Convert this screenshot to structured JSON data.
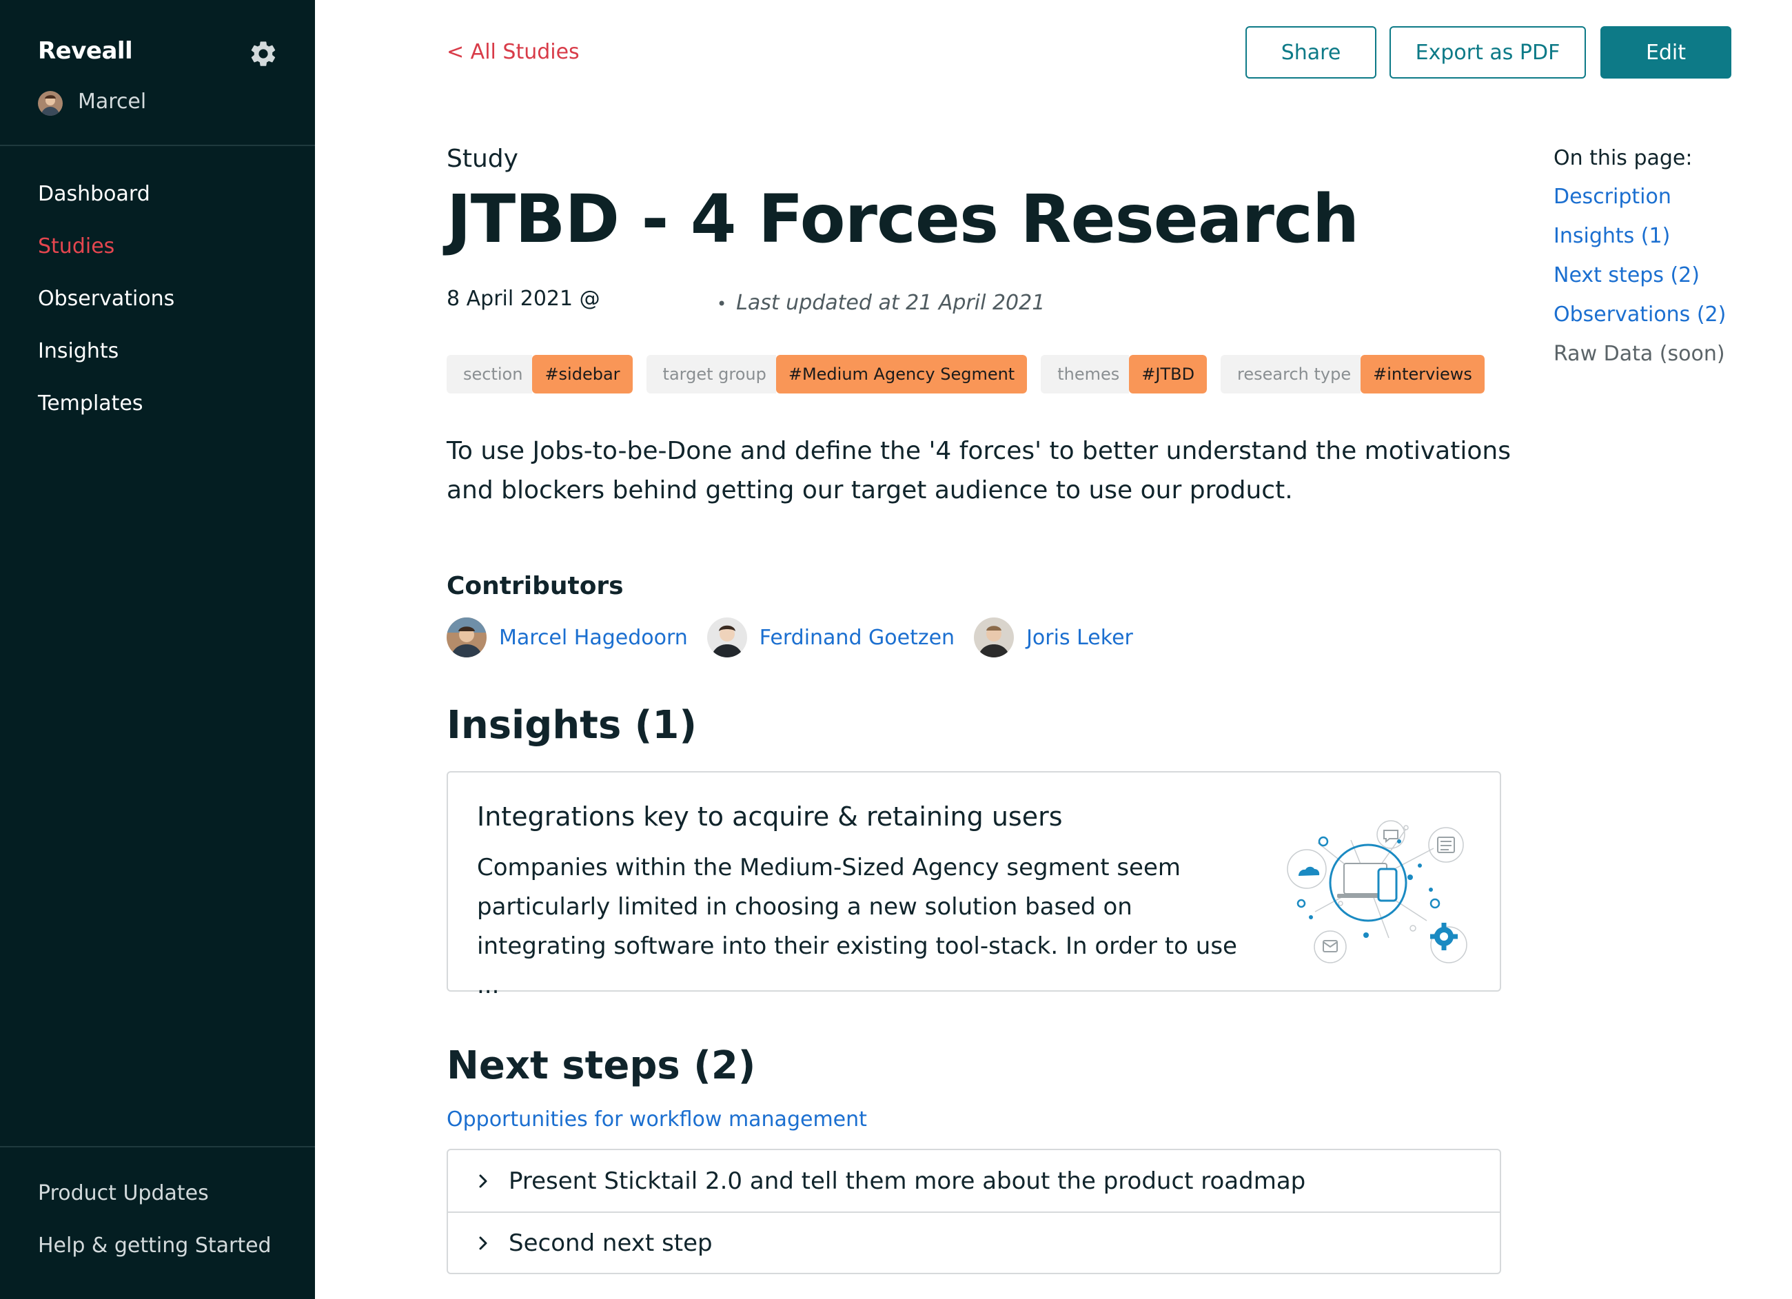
{
  "sidebar": {
    "brand": "Reveall",
    "user_name": "Marcel",
    "nav": [
      {
        "label": "Dashboard",
        "active": false
      },
      {
        "label": "Studies",
        "active": true
      },
      {
        "label": "Observations",
        "active": false
      },
      {
        "label": "Insights",
        "active": false
      },
      {
        "label": "Templates",
        "active": false
      }
    ],
    "footer": [
      {
        "label": "Product Updates"
      },
      {
        "label": "Help & getting Started"
      }
    ]
  },
  "topbar": {
    "back_label": "< All Studies",
    "share_label": "Share",
    "export_label": "Export as PDF",
    "edit_label": "Edit"
  },
  "study": {
    "kind_label": "Study",
    "title": "JTBD - 4 Forces Research",
    "date": "8 April 2021 @",
    "last_updated": "Last updated at 21 April 2021",
    "tags": [
      {
        "key": "section",
        "value": "#sidebar"
      },
      {
        "key": "target group",
        "value": "#Medium Agency Segment"
      },
      {
        "key": "themes",
        "value": "#JTBD"
      },
      {
        "key": "research type",
        "value": "#interviews"
      }
    ],
    "description": "To use Jobs-to-be-Done and define the '4 forces' to better understand the motivations and blockers behind getting our target audience to use our product."
  },
  "contributors": {
    "heading": "Contributors",
    "people": [
      {
        "name": "Marcel Hagedoorn"
      },
      {
        "name": "Ferdinand Goetzen"
      },
      {
        "name": "Joris Leker"
      }
    ]
  },
  "insights": {
    "heading": "Insights (1)",
    "card": {
      "title": "Integrations key to acquire & retaining users",
      "body": "Companies within the Medium-Sized Agency segment seem particularly limited in choosing a new solution based on integrating software into their existing tool-stack. In order to use ..."
    }
  },
  "next_steps": {
    "heading": "Next steps (2)",
    "link": "Opportunities for workflow management",
    "items": [
      {
        "label": "Present Sticktail 2.0 and tell them more about the product roadmap"
      },
      {
        "label": "Second next step"
      }
    ]
  },
  "toc": {
    "title": "On this page:",
    "items": [
      {
        "label": "Description",
        "enabled": true
      },
      {
        "label": "Insights (1)",
        "enabled": true
      },
      {
        "label": "Next steps (2)",
        "enabled": true
      },
      {
        "label": "Observations (2)",
        "enabled": true
      },
      {
        "label": "Raw Data (soon)",
        "enabled": false
      }
    ]
  },
  "colors": {
    "sidebar_bg": "#041e22",
    "accent_red": "#e5464f",
    "teal": "#0d7a87",
    "link_blue": "#1b6fd0",
    "tag_orange": "#f99657"
  },
  "icons": {
    "settings": "gear-icon",
    "step_toggle": "chevron-right-icon",
    "insight_art": "integration-network-illustration"
  }
}
